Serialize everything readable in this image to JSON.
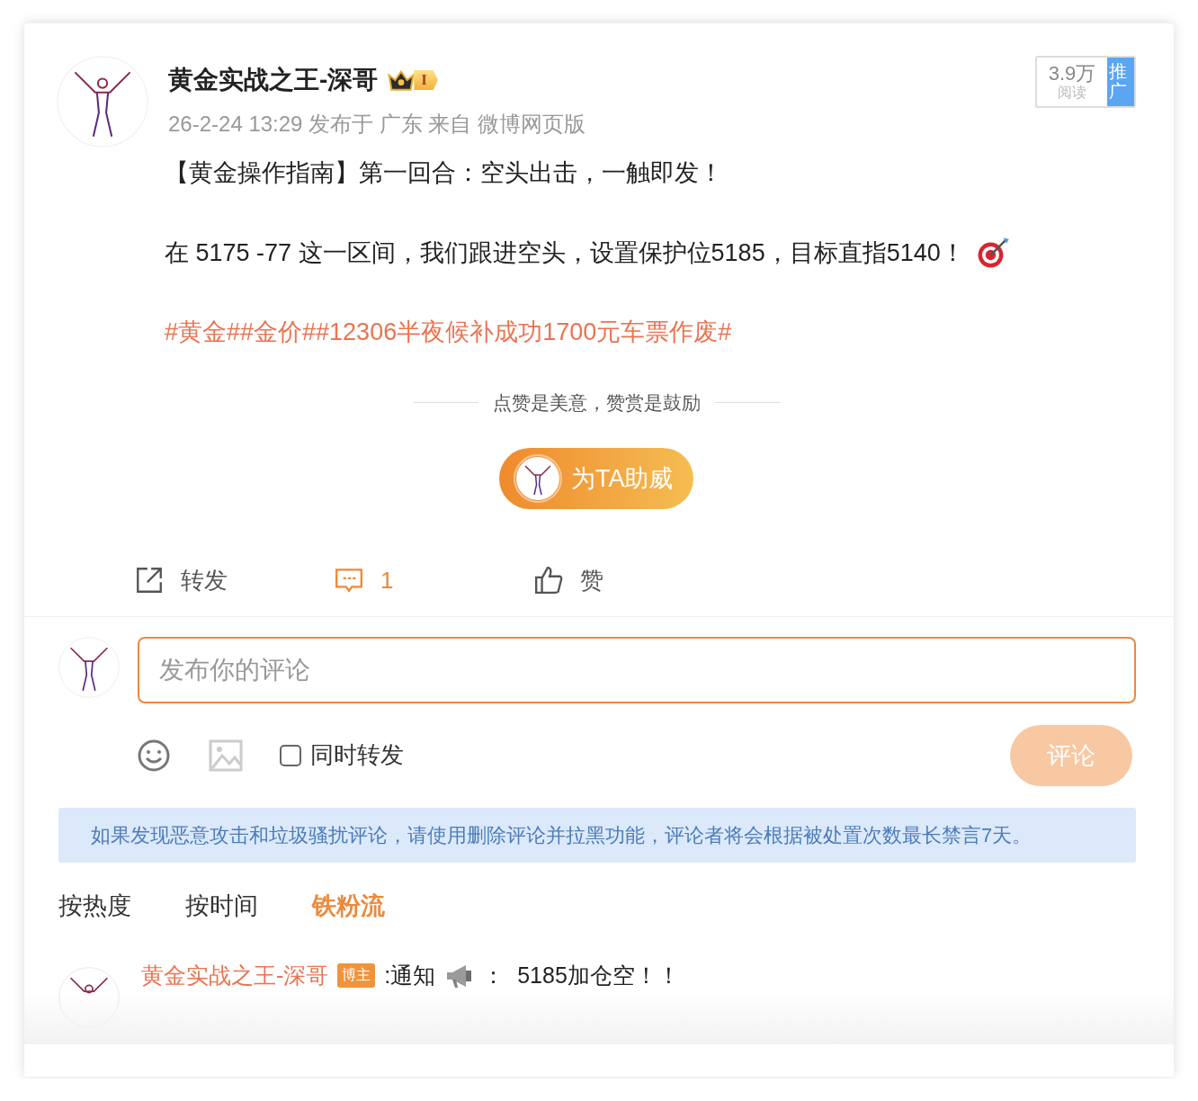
{
  "post": {
    "author": "黄金实战之王-深哥",
    "level_badge": "I",
    "meta": "26-2-24 13:29 发布于 广东 来自 微博网页版",
    "reads": {
      "count": "3.9万",
      "label": "阅读",
      "promote": "推广"
    },
    "paragraphs": [
      {
        "kind": "text",
        "text": "【黄金操作指南】第一回合：空头出击，一触即发！"
      },
      {
        "kind": "text_target",
        "text": "在 5175 -77 这一区间，我们跟进空头，设置保护位5185，目标直指5140！"
      },
      {
        "kind": "hashtags",
        "text": "#黄金##金价##12306半夜候补成功1700元车票作废#"
      }
    ],
    "reward_slogan": "点赞是美意，赞赏是鼓励",
    "reward_button": "为TA助威",
    "actions": [
      {
        "kind": "repost",
        "label": "转发",
        "selected": false
      },
      {
        "kind": "comment",
        "label": "1",
        "selected": true
      },
      {
        "kind": "like",
        "label": "赞",
        "selected": false
      }
    ]
  },
  "composer": {
    "placeholder": "发布你的评论",
    "also_repost": {
      "label": "同时转发",
      "checked": false
    },
    "submit": {
      "label": "评论",
      "disabled": true
    }
  },
  "notice": "如果发现恶意攻击和垃圾骚扰评论，请使用删除评论并拉黑功能，评论者将会根据被处置次数最长禁言7天。",
  "sort_tabs": [
    {
      "label": "按热度",
      "selected": false
    },
    {
      "label": "按时间",
      "selected": false
    },
    {
      "label": "铁粉流",
      "selected": true
    }
  ],
  "comments": [
    {
      "author": "黄金实战之王-深哥",
      "badge": "博主",
      "text_before": ":通知",
      "text_after": "：  5185加仓空！！"
    }
  ]
}
